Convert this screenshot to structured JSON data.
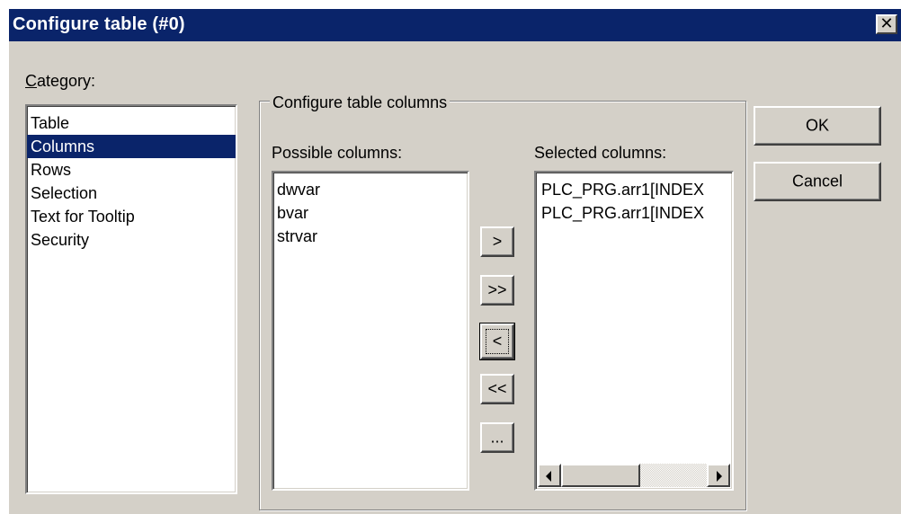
{
  "window": {
    "title": "Configure table (#0)",
    "close_glyph": "✕"
  },
  "category": {
    "label_underlined": "C",
    "label_rest": "ategory:",
    "items": [
      "Table",
      "Columns",
      "Rows",
      "Selection",
      "Text for Tooltip",
      "Security"
    ],
    "selected_index": 1
  },
  "columns_group": {
    "title": "Configure table columns",
    "possible_label": "Possible columns:",
    "possible_items": [
      "dwvar",
      "bvar",
      "strvar"
    ],
    "selected_label": "Selected columns:",
    "selected_items": [
      "PLC_PRG.arr1[INDEX",
      "PLC_PRG.arr1[INDEX"
    ]
  },
  "transfer_buttons": {
    "add": ">",
    "add_all": ">>",
    "remove": "<",
    "remove_all": "<<",
    "more": "..."
  },
  "actions": {
    "ok": "OK",
    "cancel": "Cancel"
  },
  "colors": {
    "titlebar": "#0a246a",
    "face": "#d4d0c8",
    "selection": "#0a246a"
  },
  "icons": {
    "close": "close-icon",
    "scroll_left": "scroll-left-arrow-icon",
    "scroll_right": "scroll-right-arrow-icon"
  }
}
